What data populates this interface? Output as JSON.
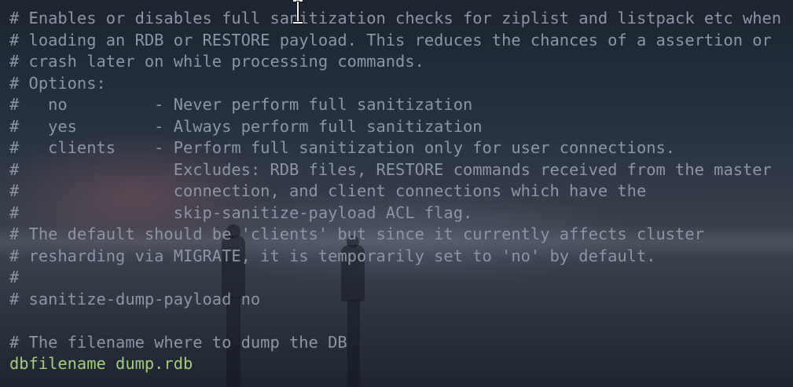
{
  "editor": {
    "lines": [
      {
        "text": "# Enables or disables full sanitization checks for ziplist and listpack etc when",
        "kind": "comment"
      },
      {
        "text": "# loading an RDB or RESTORE payload. This reduces the chances of a assertion or",
        "kind": "comment"
      },
      {
        "text": "# crash later on while processing commands.",
        "kind": "comment"
      },
      {
        "text": "# Options:",
        "kind": "comment"
      },
      {
        "text": "#   no         - Never perform full sanitization",
        "kind": "comment"
      },
      {
        "text": "#   yes        - Always perform full sanitization",
        "kind": "comment"
      },
      {
        "text": "#   clients    - Perform full sanitization only for user connections.",
        "kind": "comment"
      },
      {
        "text": "#                Excludes: RDB files, RESTORE commands received from the master",
        "kind": "comment"
      },
      {
        "text": "#                connection, and client connections which have the",
        "kind": "comment"
      },
      {
        "text": "#                skip-sanitize-payload ACL flag.",
        "kind": "comment"
      },
      {
        "text": "# The default should be 'clients' but since it currently affects cluster",
        "kind": "comment"
      },
      {
        "text": "# resharding via MIGRATE, it is temporarily set to 'no' by default.",
        "kind": "comment"
      },
      {
        "text": "#",
        "kind": "comment"
      },
      {
        "text": "# sanitize-dump-payload no",
        "kind": "comment"
      },
      {
        "text": "",
        "kind": "blank"
      },
      {
        "text": "# The filename where to dump the DB",
        "kind": "comment"
      },
      {
        "text": "dbfilename dump.rdb",
        "kind": "code"
      }
    ]
  },
  "colors": {
    "comment": "#8b95a4",
    "code": "#a3cc7a",
    "background": "#2c3340"
  },
  "icons": {
    "cursor": "text-cursor-ibeam-icon"
  }
}
